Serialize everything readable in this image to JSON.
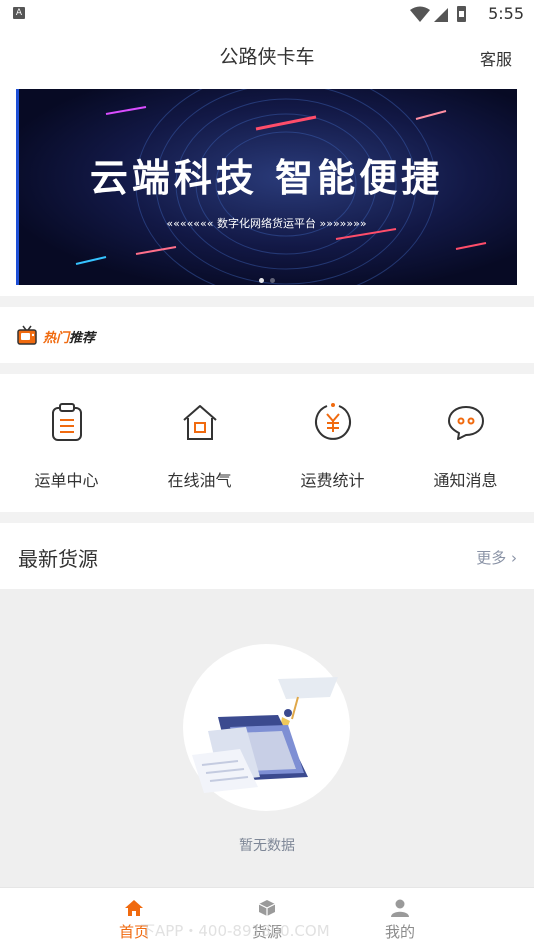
{
  "status_bar": {
    "time": "5:55",
    "notification_badge": "A"
  },
  "header": {
    "title": "公路侠卡车",
    "service_label": "客服"
  },
  "banner": {
    "headline": "云端科技  智能便捷",
    "subtitle": "«««««««   数字化网络货运平台   »»»»»»»",
    "slide_count": 2,
    "active_slide": 1
  },
  "hot": {
    "label_red": "热门",
    "label_black": "推荐",
    "icon": "tv-icon"
  },
  "features": [
    {
      "label": "运单中心",
      "icon": "clipboard-icon"
    },
    {
      "label": "在线油气",
      "icon": "house-icon"
    },
    {
      "label": "运费统计",
      "icon": "yuan-icon"
    },
    {
      "label": "通知消息",
      "icon": "chat-bubble-icon"
    }
  ],
  "newest": {
    "title": "最新货源",
    "more_label": "更多 ›"
  },
  "empty_state": {
    "text": "暂无数据"
  },
  "tabbar": {
    "tabs": [
      {
        "label": "首页",
        "icon": "home-icon",
        "active": true
      },
      {
        "label": "货源",
        "icon": "cube-icon",
        "active": false
      },
      {
        "label": "我的",
        "icon": "person-icon",
        "active": false
      }
    ],
    "watermark": "下APP・400-891800.COM"
  },
  "colors": {
    "accent": "#f06a0f",
    "muted": "#8a93a6",
    "icon_stroke": "#333333"
  }
}
